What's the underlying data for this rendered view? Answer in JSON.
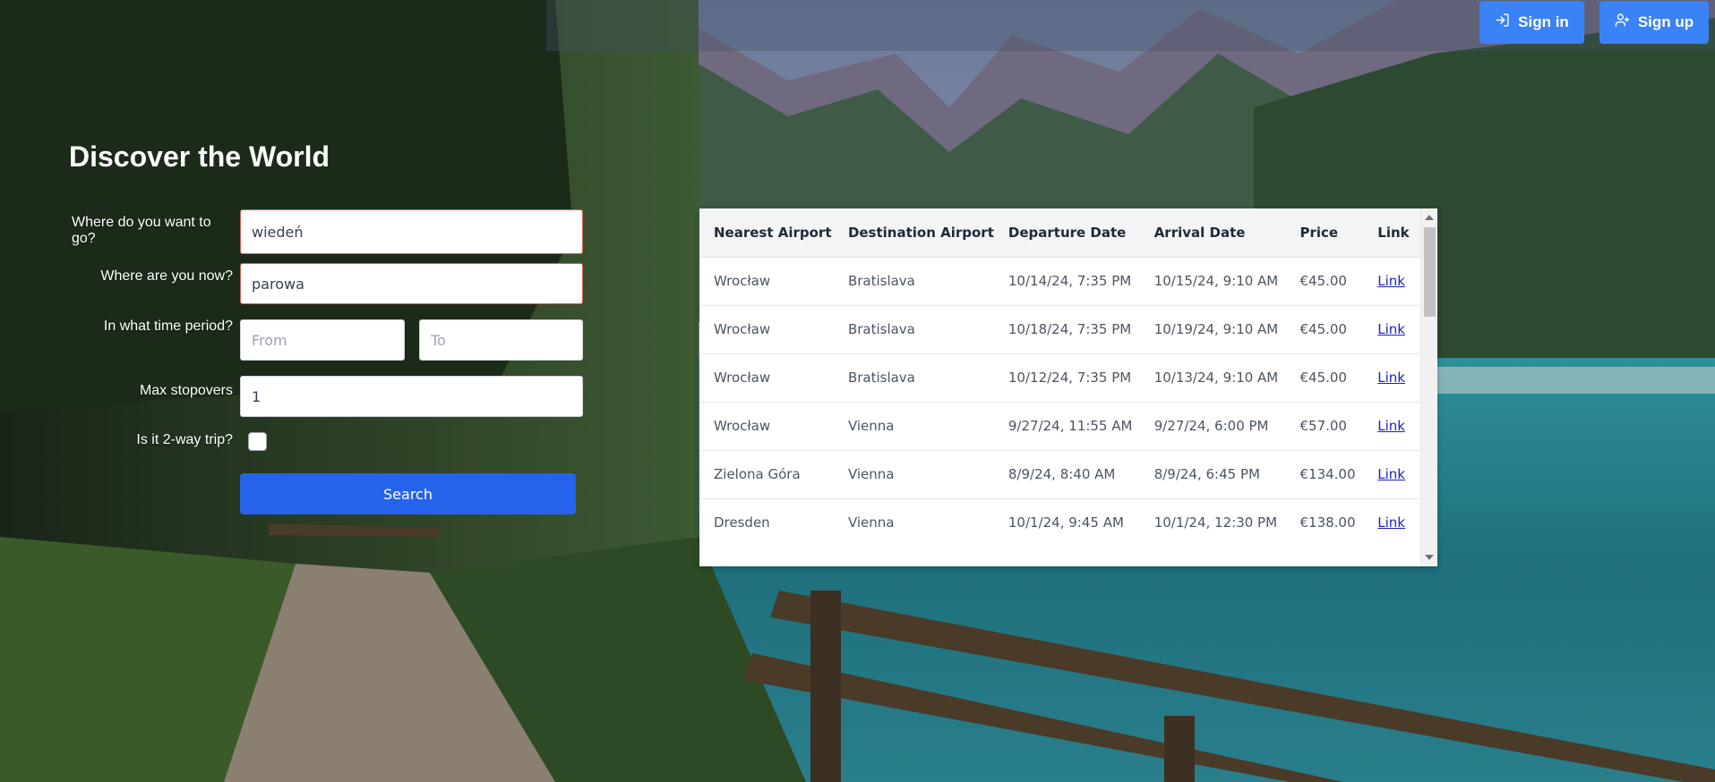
{
  "header": {
    "signin_label": "Sign in",
    "signin_icon": "sign-in-icon",
    "signup_label": "Sign up",
    "signup_icon": "user-plus-icon",
    "accent_color": "#3b82f6"
  },
  "hero": {
    "title": "Discover the World"
  },
  "form": {
    "destination_label": "Where do you want to go?",
    "destination_value": "wiedeń",
    "origin_label": "Where are you now?",
    "origin_value": "parowa",
    "period_label": "In what time period?",
    "from_placeholder": "From",
    "to_placeholder": "To",
    "stopovers_label": "Max stopovers",
    "stopovers_value": "1",
    "twoway_label": "Is it 2-way trip?",
    "twoway_checked": false,
    "search_label": "Search",
    "search_color": "#2563eb",
    "invalid_border_color": "#e25c5c"
  },
  "results": {
    "columns": [
      "Nearest Airport",
      "Destination Airport",
      "Departure Date",
      "Arrival Date",
      "Price",
      "Link"
    ],
    "rows": [
      [
        "Wrocław",
        "Bratislava",
        "10/14/24, 7:35 PM",
        "10/15/24, 9:10 AM",
        "€45.00",
        "Link"
      ],
      [
        "Wrocław",
        "Bratislava",
        "10/18/24, 7:35 PM",
        "10/19/24, 9:10 AM",
        "€45.00",
        "Link"
      ],
      [
        "Wrocław",
        "Bratislava",
        "10/12/24, 7:35 PM",
        "10/13/24, 9:10 AM",
        "€45.00",
        "Link"
      ],
      [
        "Wrocław",
        "Vienna",
        "9/27/24, 11:55 AM",
        "9/27/24, 6:00 PM",
        "€57.00",
        "Link"
      ],
      [
        "Zielona Góra",
        "Vienna",
        "8/9/24, 8:40 AM",
        "8/9/24, 6:45 PM",
        "€134.00",
        "Link"
      ],
      [
        "Dresden",
        "Vienna",
        "10/1/24, 9:45 AM",
        "10/1/24, 12:30 PM",
        "€138.00",
        "Link"
      ]
    ],
    "link_color": "#1d1dcc"
  }
}
